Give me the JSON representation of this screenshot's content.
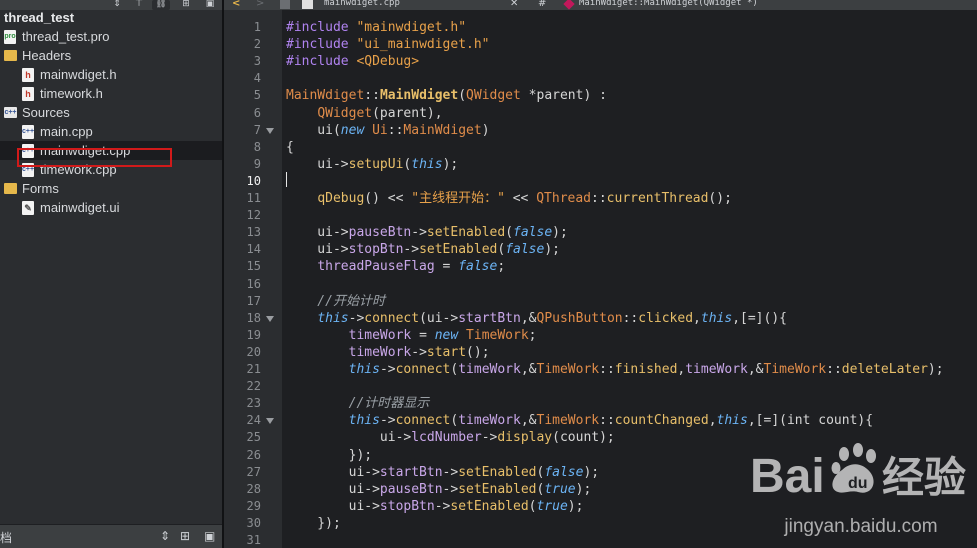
{
  "project_panel": {
    "toolbar_buttons": [
      "⇕",
      "⊤",
      "⛓",
      "⊞",
      "▣"
    ],
    "tree": [
      {
        "label": "thread_test",
        "icon": "project-icon",
        "indent": 0,
        "kind": "root"
      },
      {
        "label": "thread_test.pro",
        "icon": "pro-file-icon",
        "indent": 1,
        "kind": "pro"
      },
      {
        "label": "Headers",
        "icon": "headers-folder-icon",
        "indent": 1,
        "kind": "folder-h"
      },
      {
        "label": "mainwdiget.h",
        "icon": "header-file-icon",
        "indent": 2,
        "kind": "h"
      },
      {
        "label": "timework.h",
        "icon": "header-file-icon",
        "indent": 2,
        "kind": "h"
      },
      {
        "label": "Sources",
        "icon": "sources-folder-icon",
        "indent": 1,
        "kind": "folder-src"
      },
      {
        "label": "main.cpp",
        "icon": "cpp-file-icon",
        "indent": 2,
        "kind": "cpp"
      },
      {
        "label": "mainwdiget.cpp",
        "icon": "cpp-file-icon",
        "indent": 2,
        "kind": "cpp",
        "selected": true
      },
      {
        "label": "timework.cpp",
        "icon": "cpp-file-icon",
        "indent": 2,
        "kind": "cpp"
      },
      {
        "label": "Forms",
        "icon": "forms-folder-icon",
        "indent": 1,
        "kind": "folder-forms"
      },
      {
        "label": "mainwdiget.ui",
        "icon": "ui-file-icon",
        "indent": 2,
        "kind": "ui"
      }
    ],
    "bottom_title": "档",
    "bottom_buttons": [
      "⇕",
      "⊞",
      "▣"
    ]
  },
  "editor_toolbar": {
    "back": "<",
    "forward": ">",
    "file_name": "mainwdiget.cpp",
    "symbol_hash": "#",
    "symbol": "MainWdiget::MainWdiget(QWidget *)"
  },
  "editor": {
    "current_line": 10,
    "fold_lines": [
      7,
      18,
      24
    ],
    "lines": [
      [
        [
          "#include ",
          "t-pre"
        ],
        [
          "\"mainwdiget.h\"",
          "t-str"
        ]
      ],
      [
        [
          "#include ",
          "t-pre"
        ],
        [
          "\"ui_mainwdiget.h\"",
          "t-str"
        ]
      ],
      [
        [
          "#include ",
          "t-pre"
        ],
        [
          "<QDebug>",
          "t-str"
        ]
      ],
      [],
      [
        [
          "MainWdiget",
          "t-type"
        ],
        [
          "::",
          "t-op"
        ],
        [
          "MainWdiget",
          "t-fnb"
        ],
        [
          "(",
          "t-op"
        ],
        [
          "QWidget",
          "t-type"
        ],
        [
          " *parent) :",
          "t-op"
        ]
      ],
      [
        [
          "    ",
          "t-op"
        ],
        [
          "QWidget",
          "t-type"
        ],
        [
          "(parent),",
          "t-op"
        ]
      ],
      [
        [
          "    ui(",
          "t-op"
        ],
        [
          "new",
          "t-kw"
        ],
        [
          " ",
          "t-op"
        ],
        [
          "Ui",
          "t-type"
        ],
        [
          "::",
          "t-op"
        ],
        [
          "MainWdiget",
          "t-type"
        ],
        [
          ")",
          "t-op"
        ]
      ],
      [
        [
          "{",
          "t-op"
        ]
      ],
      [
        [
          "    ui->",
          "t-op"
        ],
        [
          "setupUi",
          "t-fn"
        ],
        [
          "(",
          "t-op"
        ],
        [
          "this",
          "t-kw"
        ],
        [
          ");",
          "t-op"
        ]
      ],
      [],
      [
        [
          "    ",
          "t-op"
        ],
        [
          "qDebug",
          "t-fn"
        ],
        [
          "() << ",
          "t-op"
        ],
        [
          "\"主线程开始：\"",
          "t-str"
        ],
        [
          " << ",
          "t-op"
        ],
        [
          "QThread",
          "t-type"
        ],
        [
          "::",
          "t-op"
        ],
        [
          "currentThread",
          "t-fn"
        ],
        [
          "();",
          "t-op"
        ]
      ],
      [],
      [
        [
          "    ui->",
          "t-op"
        ],
        [
          "pauseBtn",
          "t-mem"
        ],
        [
          "->",
          "t-op"
        ],
        [
          "setEnabled",
          "t-fn"
        ],
        [
          "(",
          "t-op"
        ],
        [
          "false",
          "t-kw"
        ],
        [
          ");",
          "t-op"
        ]
      ],
      [
        [
          "    ui->",
          "t-op"
        ],
        [
          "stopBtn",
          "t-mem"
        ],
        [
          "->",
          "t-op"
        ],
        [
          "setEnabled",
          "t-fn"
        ],
        [
          "(",
          "t-op"
        ],
        [
          "false",
          "t-kw"
        ],
        [
          ");",
          "t-op"
        ]
      ],
      [
        [
          "    ",
          "t-op"
        ],
        [
          "threadPauseFlag",
          "t-mem"
        ],
        [
          " = ",
          "t-op"
        ],
        [
          "false",
          "t-kw"
        ],
        [
          ";",
          "t-op"
        ]
      ],
      [],
      [
        [
          "    //开始计时",
          "t-cm"
        ]
      ],
      [
        [
          "    ",
          "t-op"
        ],
        [
          "this",
          "t-kw"
        ],
        [
          "->",
          "t-op"
        ],
        [
          "connect",
          "t-fn"
        ],
        [
          "(ui->",
          "t-op"
        ],
        [
          "startBtn",
          "t-mem"
        ],
        [
          ",&",
          "t-op"
        ],
        [
          "QPushButton",
          "t-type"
        ],
        [
          "::",
          "t-op"
        ],
        [
          "clicked",
          "t-fn"
        ],
        [
          ",",
          "t-op"
        ],
        [
          "this",
          "t-kw"
        ],
        [
          ",[=](){",
          "t-op"
        ]
      ],
      [
        [
          "        ",
          "t-op"
        ],
        [
          "timeWork",
          "t-mem"
        ],
        [
          " = ",
          "t-op"
        ],
        [
          "new",
          "t-kw"
        ],
        [
          " ",
          "t-op"
        ],
        [
          "TimeWork",
          "t-type"
        ],
        [
          ";",
          "t-op"
        ]
      ],
      [
        [
          "        ",
          "t-op"
        ],
        [
          "timeWork",
          "t-mem"
        ],
        [
          "->",
          "t-op"
        ],
        [
          "start",
          "t-fn"
        ],
        [
          "();",
          "t-op"
        ]
      ],
      [
        [
          "        ",
          "t-op"
        ],
        [
          "this",
          "t-kw"
        ],
        [
          "->",
          "t-op"
        ],
        [
          "connect",
          "t-fn"
        ],
        [
          "(",
          "t-op"
        ],
        [
          "timeWork",
          "t-mem"
        ],
        [
          ",&",
          "t-op"
        ],
        [
          "TimeWork",
          "t-type"
        ],
        [
          "::",
          "t-op"
        ],
        [
          "finished",
          "t-fn"
        ],
        [
          ",",
          "t-op"
        ],
        [
          "timeWork",
          "t-mem"
        ],
        [
          ",&",
          "t-op"
        ],
        [
          "TimeWork",
          "t-type"
        ],
        [
          "::",
          "t-op"
        ],
        [
          "deleteLater",
          "t-fn"
        ],
        [
          ");",
          "t-op"
        ]
      ],
      [],
      [
        [
          "        //计时器显示",
          "t-cm"
        ]
      ],
      [
        [
          "        ",
          "t-op"
        ],
        [
          "this",
          "t-kw"
        ],
        [
          "->",
          "t-op"
        ],
        [
          "connect",
          "t-fn"
        ],
        [
          "(",
          "t-op"
        ],
        [
          "timeWork",
          "t-mem"
        ],
        [
          ",&",
          "t-op"
        ],
        [
          "TimeWork",
          "t-type"
        ],
        [
          "::",
          "t-op"
        ],
        [
          "countChanged",
          "t-fn"
        ],
        [
          ",",
          "t-op"
        ],
        [
          "this",
          "t-kw"
        ],
        [
          ",[=](int count){",
          "t-op"
        ]
      ],
      [
        [
          "            ui->",
          "t-op"
        ],
        [
          "lcdNumber",
          "t-mem"
        ],
        [
          "->",
          "t-op"
        ],
        [
          "display",
          "t-fn"
        ],
        [
          "(count);",
          "t-op"
        ]
      ],
      [
        [
          "        });",
          "t-op"
        ]
      ],
      [
        [
          "        ui->",
          "t-op"
        ],
        [
          "startBtn",
          "t-mem"
        ],
        [
          "->",
          "t-op"
        ],
        [
          "setEnabled",
          "t-fn"
        ],
        [
          "(",
          "t-op"
        ],
        [
          "false",
          "t-kw"
        ],
        [
          ");",
          "t-op"
        ]
      ],
      [
        [
          "        ui->",
          "t-op"
        ],
        [
          "pauseBtn",
          "t-mem"
        ],
        [
          "->",
          "t-op"
        ],
        [
          "setEnabled",
          "t-fn"
        ],
        [
          "(",
          "t-op"
        ],
        [
          "true",
          "t-kw"
        ],
        [
          ");",
          "t-op"
        ]
      ],
      [
        [
          "        ui->",
          "t-op"
        ],
        [
          "stopBtn",
          "t-mem"
        ],
        [
          "->",
          "t-op"
        ],
        [
          "setEnabled",
          "t-fn"
        ],
        [
          "(",
          "t-op"
        ],
        [
          "true",
          "t-kw"
        ],
        [
          ");",
          "t-op"
        ]
      ],
      [
        [
          "    });",
          "t-op"
        ]
      ],
      []
    ]
  },
  "watermark": {
    "logo_text": "Bai经验",
    "url": "jingyan.baidu.com"
  },
  "colors": {
    "selection_highlight": "#d11a1a",
    "background": "#1e1f22",
    "panel": "#2b2d30"
  }
}
